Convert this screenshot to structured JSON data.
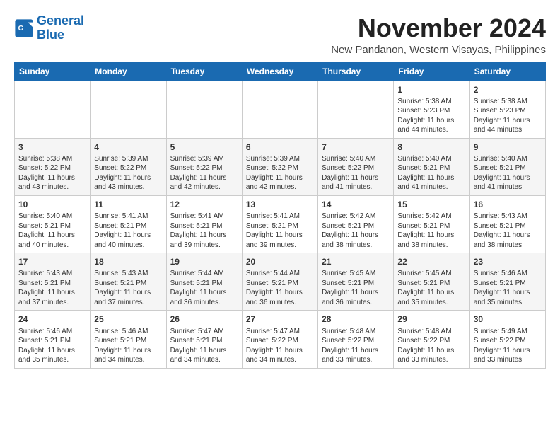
{
  "logo": {
    "line1": "General",
    "line2": "Blue"
  },
  "title": "November 2024",
  "location": "New Pandanon, Western Visayas, Philippines",
  "weekdays": [
    "Sunday",
    "Monday",
    "Tuesday",
    "Wednesday",
    "Thursday",
    "Friday",
    "Saturday"
  ],
  "weeks": [
    [
      {
        "day": "",
        "info": ""
      },
      {
        "day": "",
        "info": ""
      },
      {
        "day": "",
        "info": ""
      },
      {
        "day": "",
        "info": ""
      },
      {
        "day": "",
        "info": ""
      },
      {
        "day": "1",
        "info": "Sunrise: 5:38 AM\nSunset: 5:23 PM\nDaylight: 11 hours and 44 minutes."
      },
      {
        "day": "2",
        "info": "Sunrise: 5:38 AM\nSunset: 5:23 PM\nDaylight: 11 hours and 44 minutes."
      }
    ],
    [
      {
        "day": "3",
        "info": "Sunrise: 5:38 AM\nSunset: 5:22 PM\nDaylight: 11 hours and 43 minutes."
      },
      {
        "day": "4",
        "info": "Sunrise: 5:39 AM\nSunset: 5:22 PM\nDaylight: 11 hours and 43 minutes."
      },
      {
        "day": "5",
        "info": "Sunrise: 5:39 AM\nSunset: 5:22 PM\nDaylight: 11 hours and 42 minutes."
      },
      {
        "day": "6",
        "info": "Sunrise: 5:39 AM\nSunset: 5:22 PM\nDaylight: 11 hours and 42 minutes."
      },
      {
        "day": "7",
        "info": "Sunrise: 5:40 AM\nSunset: 5:22 PM\nDaylight: 11 hours and 41 minutes."
      },
      {
        "day": "8",
        "info": "Sunrise: 5:40 AM\nSunset: 5:21 PM\nDaylight: 11 hours and 41 minutes."
      },
      {
        "day": "9",
        "info": "Sunrise: 5:40 AM\nSunset: 5:21 PM\nDaylight: 11 hours and 41 minutes."
      }
    ],
    [
      {
        "day": "10",
        "info": "Sunrise: 5:40 AM\nSunset: 5:21 PM\nDaylight: 11 hours and 40 minutes."
      },
      {
        "day": "11",
        "info": "Sunrise: 5:41 AM\nSunset: 5:21 PM\nDaylight: 11 hours and 40 minutes."
      },
      {
        "day": "12",
        "info": "Sunrise: 5:41 AM\nSunset: 5:21 PM\nDaylight: 11 hours and 39 minutes."
      },
      {
        "day": "13",
        "info": "Sunrise: 5:41 AM\nSunset: 5:21 PM\nDaylight: 11 hours and 39 minutes."
      },
      {
        "day": "14",
        "info": "Sunrise: 5:42 AM\nSunset: 5:21 PM\nDaylight: 11 hours and 38 minutes."
      },
      {
        "day": "15",
        "info": "Sunrise: 5:42 AM\nSunset: 5:21 PM\nDaylight: 11 hours and 38 minutes."
      },
      {
        "day": "16",
        "info": "Sunrise: 5:43 AM\nSunset: 5:21 PM\nDaylight: 11 hours and 38 minutes."
      }
    ],
    [
      {
        "day": "17",
        "info": "Sunrise: 5:43 AM\nSunset: 5:21 PM\nDaylight: 11 hours and 37 minutes."
      },
      {
        "day": "18",
        "info": "Sunrise: 5:43 AM\nSunset: 5:21 PM\nDaylight: 11 hours and 37 minutes."
      },
      {
        "day": "19",
        "info": "Sunrise: 5:44 AM\nSunset: 5:21 PM\nDaylight: 11 hours and 36 minutes."
      },
      {
        "day": "20",
        "info": "Sunrise: 5:44 AM\nSunset: 5:21 PM\nDaylight: 11 hours and 36 minutes."
      },
      {
        "day": "21",
        "info": "Sunrise: 5:45 AM\nSunset: 5:21 PM\nDaylight: 11 hours and 36 minutes."
      },
      {
        "day": "22",
        "info": "Sunrise: 5:45 AM\nSunset: 5:21 PM\nDaylight: 11 hours and 35 minutes."
      },
      {
        "day": "23",
        "info": "Sunrise: 5:46 AM\nSunset: 5:21 PM\nDaylight: 11 hours and 35 minutes."
      }
    ],
    [
      {
        "day": "24",
        "info": "Sunrise: 5:46 AM\nSunset: 5:21 PM\nDaylight: 11 hours and 35 minutes."
      },
      {
        "day": "25",
        "info": "Sunrise: 5:46 AM\nSunset: 5:21 PM\nDaylight: 11 hours and 34 minutes."
      },
      {
        "day": "26",
        "info": "Sunrise: 5:47 AM\nSunset: 5:21 PM\nDaylight: 11 hours and 34 minutes."
      },
      {
        "day": "27",
        "info": "Sunrise: 5:47 AM\nSunset: 5:22 PM\nDaylight: 11 hours and 34 minutes."
      },
      {
        "day": "28",
        "info": "Sunrise: 5:48 AM\nSunset: 5:22 PM\nDaylight: 11 hours and 33 minutes."
      },
      {
        "day": "29",
        "info": "Sunrise: 5:48 AM\nSunset: 5:22 PM\nDaylight: 11 hours and 33 minutes."
      },
      {
        "day": "30",
        "info": "Sunrise: 5:49 AM\nSunset: 5:22 PM\nDaylight: 11 hours and 33 minutes."
      }
    ]
  ]
}
